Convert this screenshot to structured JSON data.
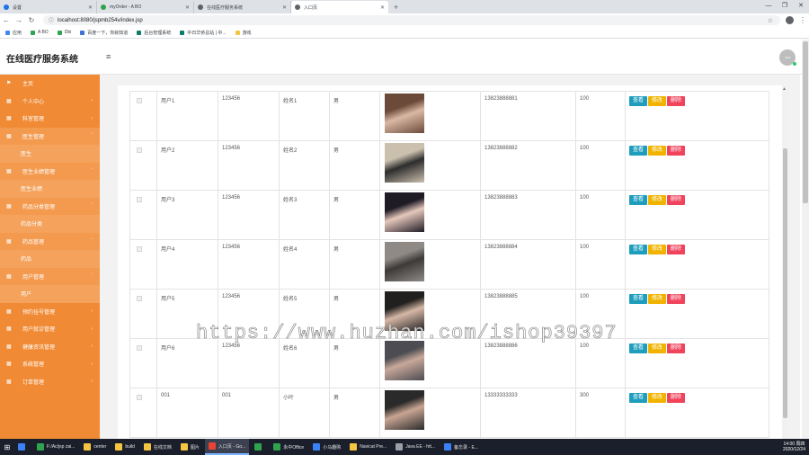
{
  "browser": {
    "tabs": [
      {
        "title": "设置",
        "icon_color": "#1a73e8",
        "active": false
      },
      {
        "title": "myOrder - A BO",
        "icon_color": "#2ea44f",
        "active": false
      },
      {
        "title": "在线医疗服务系统",
        "icon_color": "#5f6368",
        "active": false
      },
      {
        "title": "入口页",
        "icon_color": "#5f6368",
        "active": true
      }
    ],
    "new_tab": "+",
    "url": "localhost:8080/jspmb254v/index.jsp",
    "bookmarks": [
      {
        "label": "应用",
        "color": "#4285f4"
      },
      {
        "label": "A BO",
        "color": "#2ea44f"
      },
      {
        "label": "Dbi",
        "color": "#2ea44f"
      },
      {
        "label": "百度一下，你就知道",
        "color": "#3b73d9"
      },
      {
        "label": "后台管理系统",
        "color": "#0a7d6b"
      },
      {
        "label": "中日华侨总站 | 中...",
        "color": "#0a7d6b"
      },
      {
        "label": "游戏",
        "color": "#f5c542"
      }
    ]
  },
  "app": {
    "title": "在线医疗服务系统",
    "hamburger": "≡",
    "avatar_text": "Stuff"
  },
  "sidebar": {
    "items": [
      {
        "label": "主页",
        "type": "top",
        "icon": "⚑",
        "arrow": ""
      },
      {
        "label": "个人中心",
        "type": "top",
        "icon": "▦",
        "arrow": "‹"
      },
      {
        "label": "科室管理",
        "type": "top",
        "icon": "▦",
        "arrow": "‹"
      },
      {
        "label": "医生管理",
        "type": "open",
        "icon": "▦",
        "arrow": "ˇ"
      },
      {
        "label": "医生",
        "type": "sub",
        "icon": "",
        "arrow": ""
      },
      {
        "label": "医生业绩管理",
        "type": "open",
        "icon": "▦",
        "arrow": "ˇ"
      },
      {
        "label": "医生业绩",
        "type": "sub",
        "icon": "",
        "arrow": ""
      },
      {
        "label": "药品分类管理",
        "type": "open",
        "icon": "▦",
        "arrow": "ˇ"
      },
      {
        "label": "药品分类",
        "type": "sub",
        "icon": "",
        "arrow": ""
      },
      {
        "label": "药品管理",
        "type": "open",
        "icon": "▦",
        "arrow": "ˇ"
      },
      {
        "label": "药品",
        "type": "sub",
        "icon": "",
        "arrow": ""
      },
      {
        "label": "用户管理",
        "type": "open",
        "icon": "▦",
        "arrow": "ˇ"
      },
      {
        "label": "用户",
        "type": "sub",
        "icon": "",
        "arrow": ""
      },
      {
        "label": "预约挂号管理",
        "type": "top",
        "icon": "▦",
        "arrow": "‹"
      },
      {
        "label": "用户就诊管理",
        "type": "top",
        "icon": "▦",
        "arrow": "‹"
      },
      {
        "label": "健康资讯管理",
        "type": "top",
        "icon": "▦",
        "arrow": "‹"
      },
      {
        "label": "系统管理",
        "type": "top",
        "icon": "▦",
        "arrow": "‹"
      },
      {
        "label": "订单管理",
        "type": "top",
        "icon": "▦",
        "arrow": "‹"
      }
    ]
  },
  "table": {
    "buttons": {
      "view": "查看",
      "edit": "修改",
      "delete": "删除"
    },
    "rows": [
      {
        "account": "用户1",
        "password": "123456",
        "name": "姓名1",
        "gender": "男",
        "phone": "13823888881",
        "balance": "100",
        "photo": [
          "#6b4a3a",
          "#d9b8a4"
        ]
      },
      {
        "account": "用户2",
        "password": "123456",
        "name": "姓名2",
        "gender": "男",
        "phone": "13823888882",
        "balance": "100",
        "photo": [
          "#cbbfae",
          "#2d2d2d"
        ]
      },
      {
        "account": "用户3",
        "password": "123456",
        "name": "姓名3",
        "gender": "男",
        "phone": "13823888883",
        "balance": "100",
        "photo": [
          "#1f1b25",
          "#e6c8bb"
        ]
      },
      {
        "account": "用户4",
        "password": "123456",
        "name": "姓名4",
        "gender": "男",
        "phone": "13823888884",
        "balance": "100",
        "photo": [
          "#8f8a86",
          "#3d3a39"
        ]
      },
      {
        "account": "用户5",
        "password": "123456",
        "name": "姓名5",
        "gender": "男",
        "phone": "13823888885",
        "balance": "100",
        "photo": [
          "#22201f",
          "#d6b7a6"
        ]
      },
      {
        "account": "用户6",
        "password": "123456",
        "name": "姓名6",
        "gender": "男",
        "phone": "13823888886",
        "balance": "100",
        "photo": [
          "#4c4c52",
          "#c8a89a"
        ]
      },
      {
        "account": "001",
        "password": "001",
        "name": "小叶",
        "gender": "男",
        "phone": "13333333333",
        "balance": "300",
        "photo": [
          "#2a2a2a",
          "#c9a593"
        ]
      }
    ]
  },
  "watermark": "https://www.huzhan.com/ishop39397",
  "taskbar": {
    "items": [
      {
        "label": "",
        "color": "#3b82f6"
      },
      {
        "label": "F:/Ac/jsp zai...",
        "color": "#2ea44f"
      },
      {
        "label": "center",
        "color": "#f5c542"
      },
      {
        "label": "build",
        "color": "#f5c542"
      },
      {
        "label": "在线文档",
        "color": "#f5c542"
      },
      {
        "label": "图片",
        "color": "#f5c542"
      },
      {
        "label": "入口页 - Go...",
        "color": "#ea4335"
      },
      {
        "label": "",
        "color": "#2ea44f"
      },
      {
        "label": "永中Office",
        "color": "#2ea44f"
      },
      {
        "label": "小马趣购",
        "color": "#3b82f6"
      },
      {
        "label": "Navicat Pre...",
        "color": "#f5c542"
      },
      {
        "label": "Java EE - htt...",
        "color": "#9aa0a6"
      },
      {
        "label": "备忘录 - E...",
        "color": "#3b82f6"
      }
    ],
    "active_index": 6,
    "time": "14:00 周四",
    "date": "2020/12/24"
  }
}
